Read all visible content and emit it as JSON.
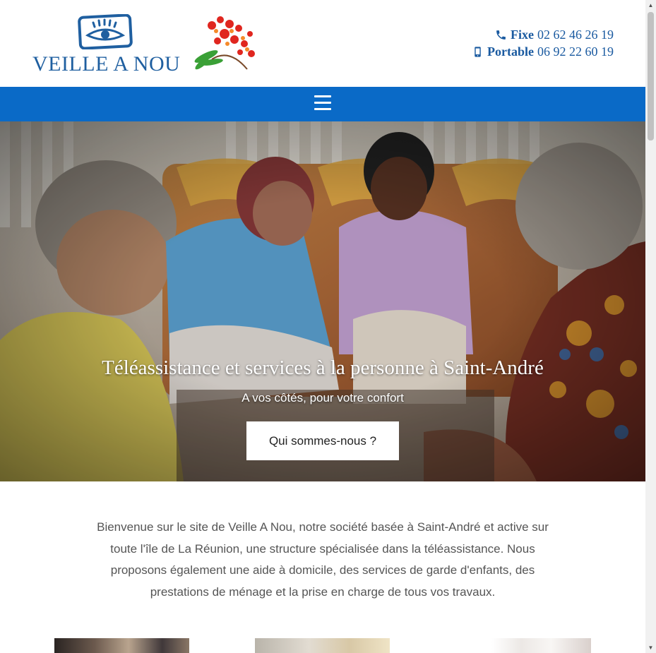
{
  "brand": {
    "logo_text": "VEILLE A NOU",
    "logo_icon": "eye-logo-icon",
    "flower_icon": "flamboyant-flower-icon",
    "color": "#1f5fa0"
  },
  "contact": {
    "fixe_label": "Fixe",
    "fixe_number": "02 62 46 26 19",
    "fixe_icon": "phone-icon",
    "portable_label": "Portable",
    "portable_number": "06 92 22 60 19",
    "portable_icon": "mobile-phone-icon"
  },
  "nav": {
    "menu_icon": "hamburger-menu-icon",
    "color": "#0a6ac7"
  },
  "hero": {
    "title": "Téléassistance et services à la personne à Saint-André",
    "subtitle": "A vos côtés, pour votre confort",
    "button_label": "Qui sommes-nous ?"
  },
  "intro": {
    "text": "Bienvenue sur le site de Veille A Nou, notre société basée à Saint-André et active sur toute l'île de La Réunion, une structure spécialisée dans la téléassistance. Nous proposons également une aide à domicile, des services de garde d'enfants, des prestations de ménage et la prise en charge de tous vos travaux."
  },
  "scrollbar": {
    "up_icon": "scroll-up-arrow-icon",
    "down_icon": "scroll-down-arrow-icon"
  }
}
